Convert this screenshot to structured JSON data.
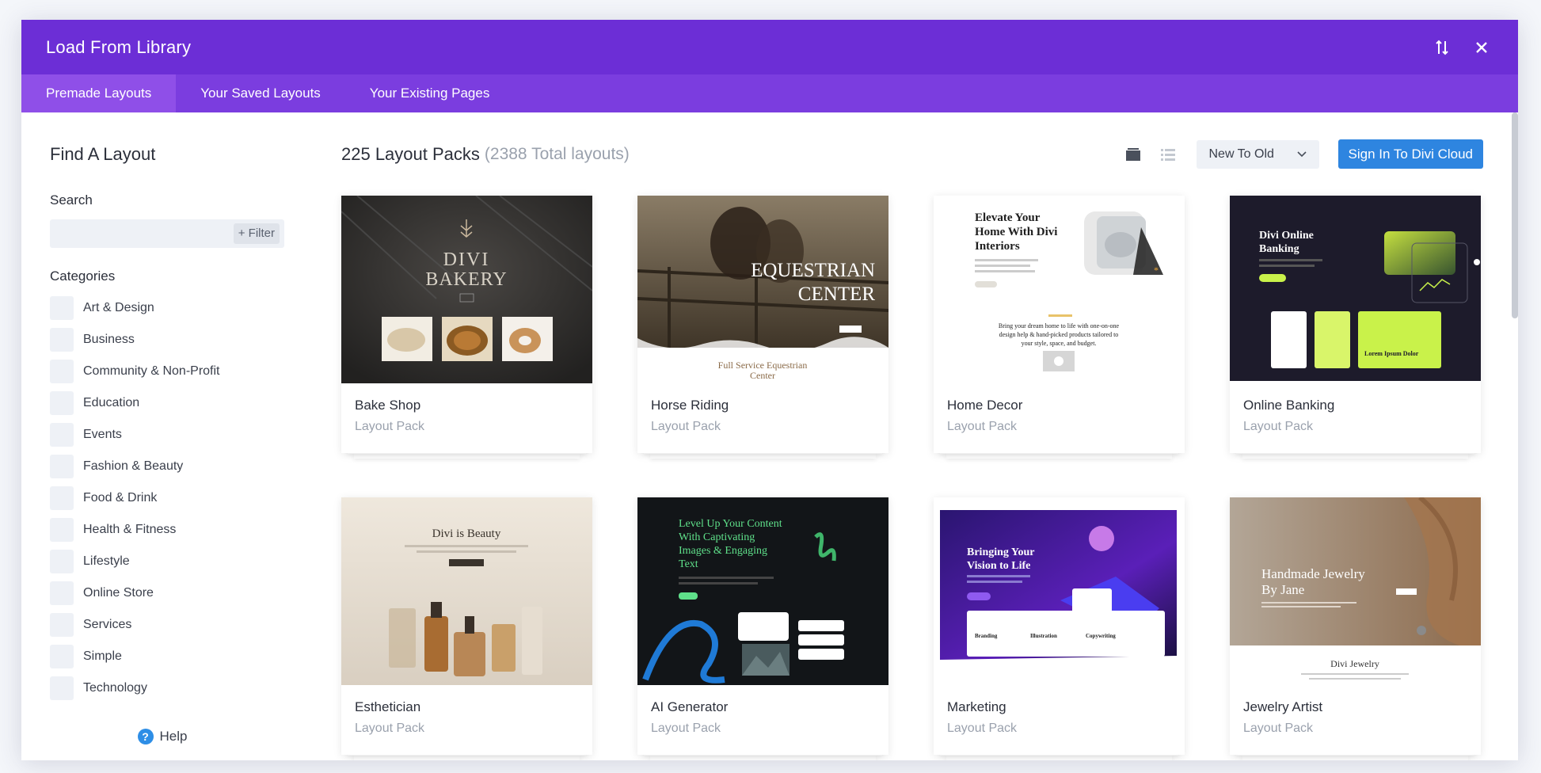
{
  "window": {
    "title": "Load From Library"
  },
  "tabs": [
    {
      "label": "Premade Layouts",
      "active": true
    },
    {
      "label": "Your Saved Layouts",
      "active": false
    },
    {
      "label": "Your Existing Pages",
      "active": false
    }
  ],
  "sidebar": {
    "heading": "Find A Layout",
    "search_label": "Search",
    "search_value": "",
    "filter_label": "+ Filter",
    "categories_label": "Categories",
    "categories": [
      "Art & Design",
      "Business",
      "Community & Non-Profit",
      "Education",
      "Events",
      "Fashion & Beauty",
      "Food & Drink",
      "Health & Fitness",
      "Lifestyle",
      "Online Store",
      "Services",
      "Simple",
      "Technology"
    ],
    "help_label": "Help"
  },
  "main": {
    "packs_count": "225 Layout Packs",
    "packs_total": "(2388 Total layouts)",
    "sort_value": "New To Old",
    "signin_label": "Sign In To Divi Cloud"
  },
  "cards": [
    {
      "name": "Bake Shop",
      "type": "Layout Pack"
    },
    {
      "name": "Horse Riding",
      "type": "Layout Pack"
    },
    {
      "name": "Home Decor",
      "type": "Layout Pack"
    },
    {
      "name": "Online Banking",
      "type": "Layout Pack"
    },
    {
      "name": "Esthetician",
      "type": "Layout Pack"
    },
    {
      "name": "AI Generator",
      "type": "Layout Pack"
    },
    {
      "name": "Marketing",
      "type": "Layout Pack"
    },
    {
      "name": "Jewelry Artist",
      "type": "Layout Pack"
    }
  ],
  "thumbs": {
    "bakery": {
      "line1": "DIVI",
      "line2": "BAKERY"
    },
    "equestrian": {
      "line1": "EQUESTRIAN",
      "line2": "CENTER",
      "sub1": "Full Service Equestrian",
      "sub2": "Center"
    },
    "homedecor": {
      "line1": "Elevate Your",
      "line2": "Home With Divi",
      "line3": "Interiors",
      "body1": "Bring your dream home to life with one-on-one",
      "body2": "design help & hand-picked products tailored to",
      "body3": "your style, space, and budget."
    },
    "banking": {
      "line1": "Divi Online",
      "line2": "Banking",
      "card_text": "Lorem Ipsum Dolor"
    },
    "beauty": {
      "title": "Divi is Beauty"
    },
    "ai": {
      "line1": "Level Up Your Content",
      "line2": "With Captivating",
      "line3": "Images & Engaging",
      "line4": "Text"
    },
    "marketing": {
      "line1": "Bringing Your",
      "line2": "Vision to Life",
      "f1": "Branding",
      "f2": "Illustration",
      "f3": "Copywriting"
    },
    "jewelry": {
      "line1": "Handmade Jewelry",
      "line2": "By Jane",
      "sub": "Divi Jewelry"
    }
  },
  "colors": {
    "titlebar": "#6c2ed6",
    "tabbar": "#7b3ddf",
    "active_tab": "#8f4fe8",
    "signin": "#2e85e0"
  }
}
